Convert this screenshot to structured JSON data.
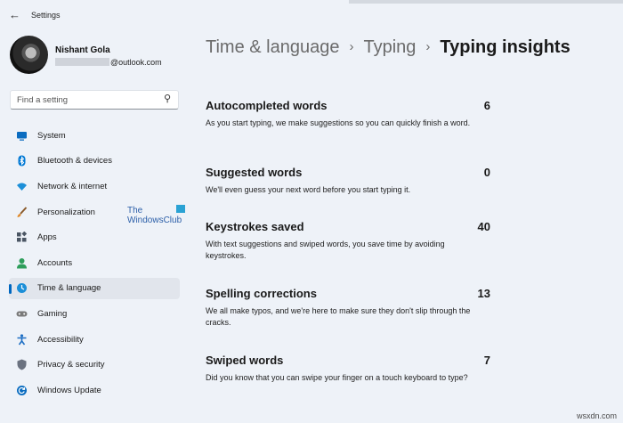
{
  "app": {
    "title": "Settings"
  },
  "user": {
    "name": "Nishant Gola",
    "email_domain": "@outlook.com"
  },
  "search": {
    "placeholder": "Find a setting"
  },
  "sidebar": {
    "items": [
      {
        "label": "System",
        "icon": "monitor-icon",
        "color": "#0a6cc0"
      },
      {
        "label": "Bluetooth & devices",
        "icon": "bluetooth-icon",
        "color": "#0078d4"
      },
      {
        "label": "Network & internet",
        "icon": "wifi-icon",
        "color": "#1c8fd8"
      },
      {
        "label": "Personalization",
        "icon": "brush-icon",
        "color": "#e08a2c"
      },
      {
        "label": "Apps",
        "icon": "apps-icon",
        "color": "#4a5563"
      },
      {
        "label": "Accounts",
        "icon": "person-icon",
        "color": "#2e9e5b"
      },
      {
        "label": "Time & language",
        "icon": "globe-clock-icon",
        "color": "#1c8fd8",
        "active": true
      },
      {
        "label": "Gaming",
        "icon": "gamepad-icon",
        "color": "#7a7a7a"
      },
      {
        "label": "Accessibility",
        "icon": "accessibility-icon",
        "color": "#1e6fc4"
      },
      {
        "label": "Privacy & security",
        "icon": "shield-icon",
        "color": "#6b7280"
      },
      {
        "label": "Windows Update",
        "icon": "update-icon",
        "color": "#0a6cc0"
      }
    ]
  },
  "watermark": {
    "line1": "The",
    "line2": "WindowsClub"
  },
  "breadcrumb": {
    "items": [
      "Time & language",
      "Typing"
    ],
    "current": "Typing insights",
    "separator": "›"
  },
  "insights": [
    {
      "title": "Autocompleted words",
      "value": "6",
      "desc": "As you start typing, we make suggestions so you can quickly finish a word."
    },
    {
      "title": "Suggested words",
      "value": "0",
      "desc": "We'll even guess your next word before you start typing it."
    },
    {
      "title": "Keystrokes saved",
      "value": "40",
      "desc": "With text suggestions and swiped words, you save time by avoiding keystrokes."
    },
    {
      "title": "Spelling corrections",
      "value": "13",
      "desc": "We all make typos, and we're here to make sure they don't slip through the cracks."
    },
    {
      "title": "Swiped words",
      "value": "7",
      "desc": "Did you know that you can swipe your finger on a touch keyboard to type?"
    }
  ],
  "footer": {
    "text": "wsxdn.com"
  }
}
